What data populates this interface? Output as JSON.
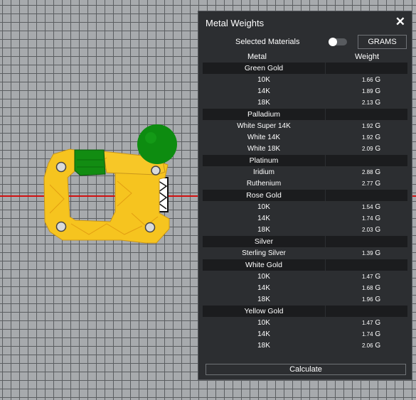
{
  "panel": {
    "title": "Metal Weights",
    "close_icon": "close-icon",
    "selected_materials_label": "Selected Materials",
    "unit_button": "GRAMS",
    "col_metal": "Metal",
    "col_weight": "Weight",
    "calculate_button": "Calculate",
    "groups": [
      {
        "name": "Green Gold",
        "items": [
          {
            "name": "10K",
            "weight": "1.66",
            "unit": "G"
          },
          {
            "name": "14K",
            "weight": "1.89",
            "unit": "G"
          },
          {
            "name": "18K",
            "weight": "2.13",
            "unit": "G"
          }
        ]
      },
      {
        "name": "Palladium",
        "items": [
          {
            "name": "White Super 14K",
            "weight": "1.92",
            "unit": "G"
          },
          {
            "name": "White 14K",
            "weight": "1.92",
            "unit": "G"
          },
          {
            "name": "White 18K",
            "weight": "2.09",
            "unit": "G"
          }
        ]
      },
      {
        "name": "Platinum",
        "items": [
          {
            "name": "Iridium",
            "weight": "2.88",
            "unit": "G"
          },
          {
            "name": "Ruthenium",
            "weight": "2.77",
            "unit": "G"
          }
        ]
      },
      {
        "name": "Rose Gold",
        "items": [
          {
            "name": "10K",
            "weight": "1.54",
            "unit": "G"
          },
          {
            "name": "14K",
            "weight": "1.74",
            "unit": "G"
          },
          {
            "name": "18K",
            "weight": "2.03",
            "unit": "G"
          }
        ]
      },
      {
        "name": "Silver",
        "items": [
          {
            "name": "Sterling Silver",
            "weight": "1.39",
            "unit": "G"
          }
        ]
      },
      {
        "name": "White Gold",
        "items": [
          {
            "name": "10K",
            "weight": "1.47",
            "unit": "G"
          },
          {
            "name": "14K",
            "weight": "1.68",
            "unit": "G"
          },
          {
            "name": "18K",
            "weight": "1.96",
            "unit": "G"
          }
        ]
      },
      {
        "name": "Yellow Gold",
        "items": [
          {
            "name": "10K",
            "weight": "1.47",
            "unit": "G"
          },
          {
            "name": "14K",
            "weight": "1.74",
            "unit": "G"
          },
          {
            "name": "18K",
            "weight": "2.06",
            "unit": "G"
          }
        ]
      }
    ]
  },
  "colors": {
    "panel_bg": "#2c2e31",
    "group_header_bg": "#1b1c1e",
    "model_yellow": "#f5c21c",
    "model_green": "#0d8c10",
    "axis_red": "#d10f0f"
  }
}
